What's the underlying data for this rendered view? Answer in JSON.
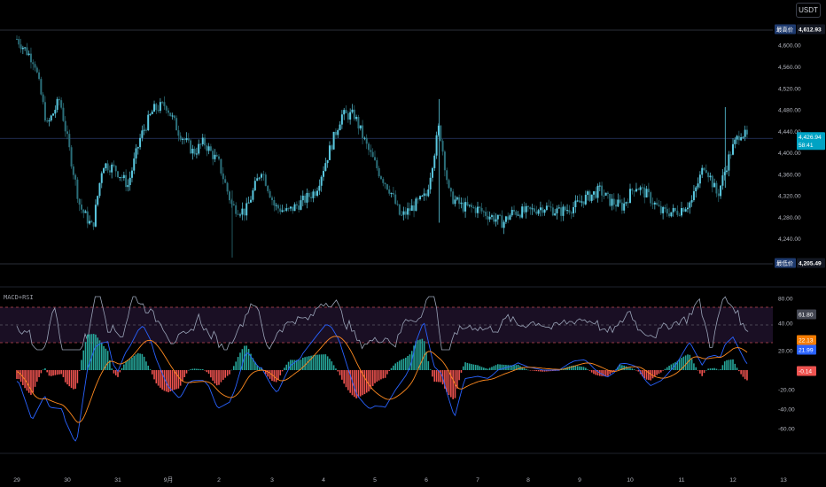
{
  "toolbar": {
    "currency": "USDT"
  },
  "colors": {
    "up": "#5ac8e0",
    "down": "#2b6f7a",
    "macd_line": "#2962ff",
    "signal_line": "#ff8a1f",
    "rsi_line": "#9aa4b8",
    "hist_pos": "#26a69a",
    "hist_neg": "#ef5350",
    "rsi_band_fill": "#1a0f24",
    "rsi_band_border": "#c04a57"
  },
  "price_panel": {
    "high_label": "最高价",
    "high_value": "4,612.93",
    "low_label": "最低价",
    "low_value": "4,205.49",
    "current_value": "4,426.94",
    "countdown": "58:41",
    "y_ticks": [
      "4,600.00",
      "4,560.00",
      "4,520.00",
      "4,480.00",
      "4,440.00",
      "4,400.00",
      "4,360.00",
      "4,320.00",
      "4,280.00",
      "4,240.00"
    ]
  },
  "indicator_panel": {
    "title": "MACD+RSI",
    "y_ticks": [
      "80.00",
      "40.00",
      "20.00",
      "-20.00",
      "-40.00",
      "-60.00"
    ],
    "rsi_badge": "61.80",
    "signal_badge": "22.13",
    "macd_badge": "21.99",
    "hist_badge": "-0.14"
  },
  "time_axis": {
    "ticks": [
      "29",
      "30",
      "31",
      "9月",
      "2",
      "3",
      "4",
      "5",
      "6",
      "7",
      "8",
      "9",
      "10",
      "11",
      "12",
      "13"
    ]
  },
  "chart_data": {
    "type": "candlestick",
    "y_range": [
      4195,
      4630
    ],
    "high": 4612.93,
    "low": 4205.49,
    "last": 4426.94,
    "x_labels": [
      "29",
      "30",
      "31",
      "9月",
      "2",
      "3",
      "4",
      "5",
      "6",
      "7",
      "8",
      "9",
      "10",
      "11",
      "12",
      "13"
    ],
    "close_path": [
      [
        0,
        4612
      ],
      [
        0.35,
        4570
      ],
      [
        0.6,
        4450
      ],
      [
        0.85,
        4500
      ],
      [
        1.05,
        4400
      ],
      [
        1.25,
        4300
      ],
      [
        1.5,
        4260
      ],
      [
        1.7,
        4380
      ],
      [
        1.95,
        4370
      ],
      [
        2.2,
        4340
      ],
      [
        2.45,
        4430
      ],
      [
        2.7,
        4480
      ],
      [
        2.95,
        4490
      ],
      [
        3.2,
        4440
      ],
      [
        3.5,
        4400
      ],
      [
        3.7,
        4420
      ],
      [
        4.0,
        4380
      ],
      [
        4.25,
        4300
      ],
      [
        4.5,
        4290
      ],
      [
        4.8,
        4370
      ],
      [
        5.05,
        4300
      ],
      [
        5.3,
        4290
      ],
      [
        5.6,
        4310
      ],
      [
        5.85,
        4330
      ],
      [
        6.1,
        4400
      ],
      [
        6.35,
        4470
      ],
      [
        6.6,
        4470
      ],
      [
        6.85,
        4410
      ],
      [
        7.1,
        4360
      ],
      [
        7.3,
        4330
      ],
      [
        7.5,
        4280
      ],
      [
        7.75,
        4300
      ],
      [
        8.0,
        4320
      ],
      [
        8.25,
        4450
      ],
      [
        8.45,
        4320
      ],
      [
        8.7,
        4300
      ],
      [
        9.0,
        4295
      ],
      [
        9.3,
        4280
      ],
      [
        9.5,
        4270
      ],
      [
        9.7,
        4290
      ],
      [
        10.0,
        4290
      ],
      [
        10.3,
        4300
      ],
      [
        10.6,
        4290
      ],
      [
        10.9,
        4300
      ],
      [
        11.1,
        4315
      ],
      [
        11.4,
        4330
      ],
      [
        11.6,
        4310
      ],
      [
        11.85,
        4300
      ],
      [
        12.1,
        4340
      ],
      [
        12.35,
        4320
      ],
      [
        12.6,
        4290
      ],
      [
        12.9,
        4290
      ],
      [
        13.2,
        4310
      ],
      [
        13.45,
        4380
      ],
      [
        13.7,
        4320
      ],
      [
        13.95,
        4400
      ],
      [
        14.15,
        4440
      ],
      [
        14.3,
        4426.94
      ]
    ],
    "indicators": {
      "rsi_band": [
        30,
        70
      ],
      "rsi_last": 61.8,
      "macd_last": 21.99,
      "signal_last": 22.13,
      "hist_last": -0.14
    }
  }
}
